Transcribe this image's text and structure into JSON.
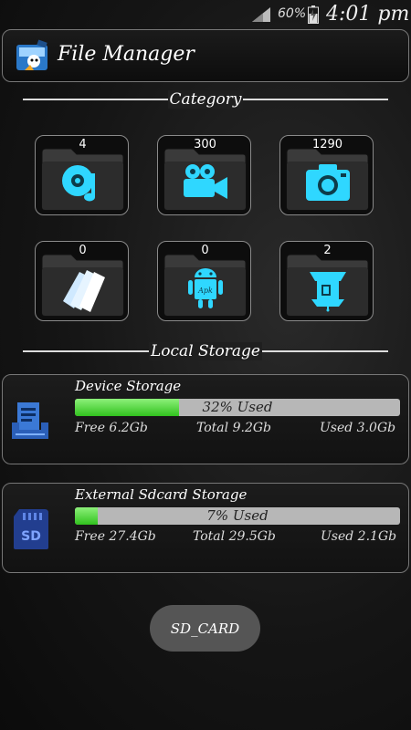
{
  "status_bar": {
    "battery_level": "60%",
    "time": "4:01 pm"
  },
  "header": {
    "title": "File Manager",
    "logo_icon": "file-manager-logo-icon"
  },
  "sections": {
    "category_label": "Category",
    "local_storage_label": "Local Storage"
  },
  "categories": [
    {
      "count": "4",
      "icon": "music-disc-icon"
    },
    {
      "count": "300",
      "icon": "video-camera-icon"
    },
    {
      "count": "1290",
      "icon": "photo-camera-icon"
    },
    {
      "count": "0",
      "icon": "documents-icon"
    },
    {
      "count": "0",
      "icon": "android-apk-icon"
    },
    {
      "count": "2",
      "icon": "zip-archive-icon"
    }
  ],
  "storage": [
    {
      "title": "Device Storage",
      "used_label": "32% Used",
      "used_fraction": 0.32,
      "free": "Free 6.2Gb",
      "total": "Total 9.2Gb",
      "used": "Used 3.0Gb",
      "icon": "device-storage-icon"
    },
    {
      "title": "External Sdcard Storage",
      "used_label": "7% Used",
      "used_fraction": 0.07,
      "free": "Free 27.4Gb",
      "total": "Total 29.5Gb",
      "used": "Used 2.1Gb",
      "icon": "sd-card-icon"
    }
  ],
  "sd_button_label": "SD_CARD",
  "colors": {
    "accent_cyan": "#2fd7ff",
    "bar_fill": "#3ccf2a",
    "bar_track": "#b7b7b7"
  }
}
